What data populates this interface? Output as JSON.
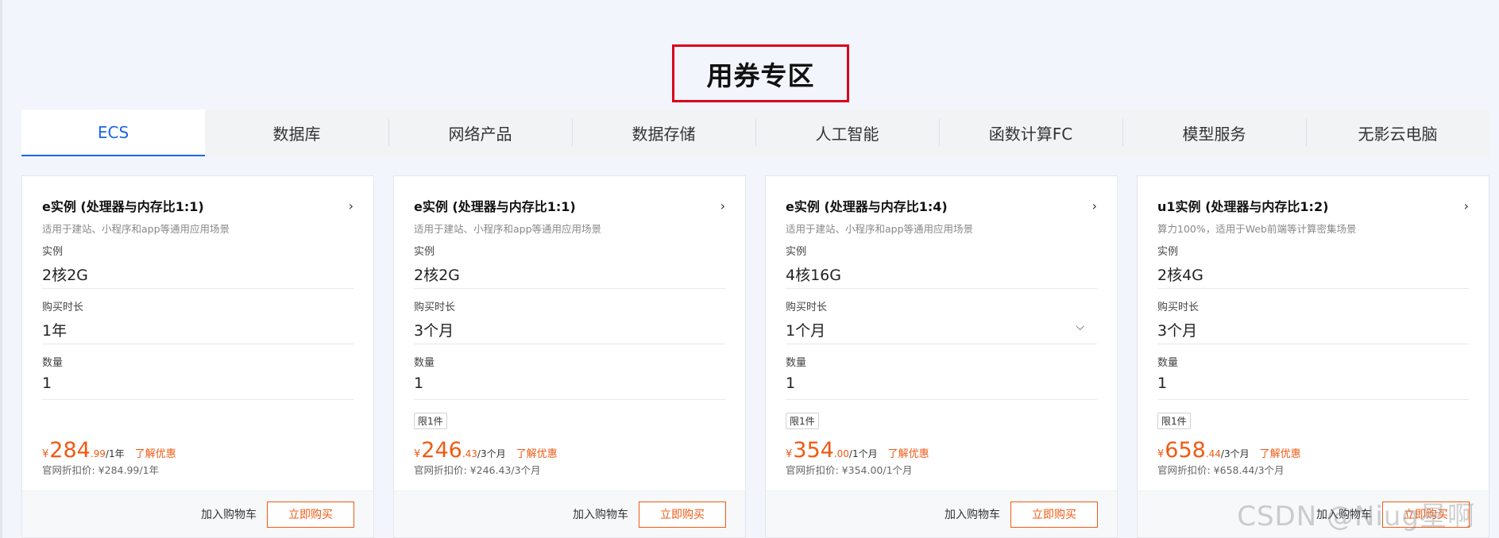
{
  "page_title": "用券专区",
  "tabs": [
    {
      "label": "ECS"
    },
    {
      "label": "数据库"
    },
    {
      "label": "网络产品"
    },
    {
      "label": "数据存储"
    },
    {
      "label": "人工智能"
    },
    {
      "label": "函数计算FC"
    },
    {
      "label": "模型服务"
    },
    {
      "label": "无影云电脑"
    }
  ],
  "active_tab": "ECS",
  "field_labels": {
    "instance": "实例",
    "duration": "购买时长",
    "quantity": "数量"
  },
  "cards": [
    {
      "title": "e实例 (处理器与内存比1:1)",
      "subtitle": "适用于建站、小程序和app等通用应用场景",
      "instance": "2核2G",
      "duration": "1年",
      "quantity": "1",
      "limit": "",
      "price_yen": "¥",
      "price_int": "284",
      "price_dec": ".99",
      "price_unit": "/1年",
      "promo": "了解优惠",
      "original_price": "官网折扣价: ¥284.99/1年",
      "cart": "加入购物车",
      "buy": "立即购买"
    },
    {
      "title": "e实例 (处理器与内存比1:1)",
      "subtitle": "适用于建站、小程序和app等通用应用场景",
      "instance": "2核2G",
      "duration": "3个月",
      "quantity": "1",
      "limit": "限1件",
      "price_yen": "¥",
      "price_int": "246",
      "price_dec": ".43",
      "price_unit": "/3个月",
      "promo": "了解优惠",
      "original_price": "官网折扣价: ¥246.43/3个月",
      "cart": "加入购物车",
      "buy": "立即购买"
    },
    {
      "title": "e实例 (处理器与内存比1:4)",
      "subtitle": "适用于建站、小程序和app等通用应用场景",
      "instance": "4核16G",
      "duration": "1个月",
      "quantity": "1",
      "limit": "限1件",
      "price_yen": "¥",
      "price_int": "354",
      "price_dec": ".00",
      "price_unit": "/1个月",
      "promo": "了解优惠",
      "original_price": "官网折扣价: ¥354.00/1个月",
      "cart": "加入购物车",
      "buy": "立即购买"
    },
    {
      "title": "u1实例 (处理器与内存比1:2)",
      "subtitle": "算力100%，适用于Web前端等计算密集场景",
      "instance": "2核4G",
      "duration": "3个月",
      "quantity": "1",
      "limit": "限1件",
      "price_yen": "¥",
      "price_int": "658",
      "price_dec": ".44",
      "price_unit": "/3个月",
      "promo": "了解优惠",
      "original_price": "官网折扣价: ¥658.44/3个月",
      "cart": "加入购物车",
      "buy": "立即购买"
    }
  ],
  "watermark": "CSDN @Niug星啊",
  "colors": {
    "accent": "#1a66e8",
    "price": "#f05a14",
    "highlight_box": "#d9001b"
  }
}
